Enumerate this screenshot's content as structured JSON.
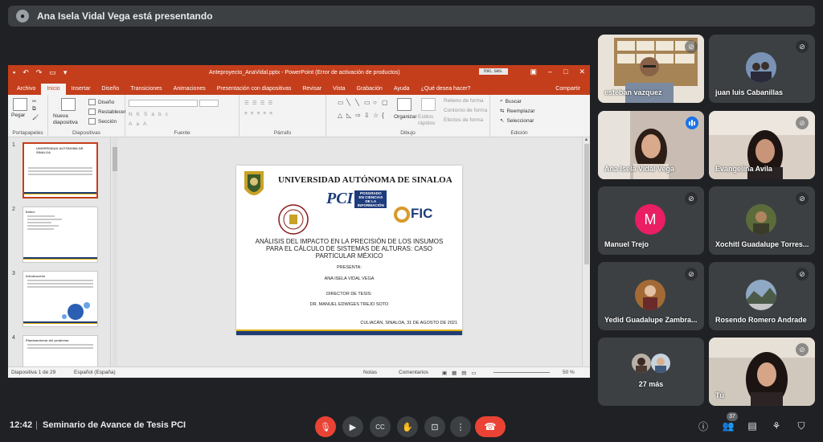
{
  "banner": {
    "text": "Ana Isela Vidal Vega está presentando"
  },
  "ppt": {
    "window_title": "Anteproyecto_AnaVidal.pptx  -  PowerPoint (Error de activación de productos)",
    "signin": "Inic. ses.",
    "tabs": [
      "Archivo",
      "Inicio",
      "Insertar",
      "Diseño",
      "Transiciones",
      "Animaciones",
      "Presentación con diapositivas",
      "Revisar",
      "Vista",
      "Grabación",
      "Ayuda",
      "¿Qué desea hacer?"
    ],
    "share": "Compartir",
    "ribbon": {
      "paste": "Pegar",
      "new_slide": "Nueva diapositiva",
      "layout": "Diseño",
      "reset": "Restablecer",
      "section": "Sección",
      "arrange": "Organizar",
      "quick_styles": "Estilos rápidos",
      "shape_fill": "Relleno de forma",
      "shape_outline": "Contorno de forma",
      "shape_effects": "Efectos de forma",
      "find": "Buscar",
      "replace": "Reemplazar",
      "select": "Seleccionar",
      "groups": [
        "Portapapeles",
        "Diapositivas",
        "Fuente",
        "Párrafo",
        "Dibujo",
        "Edición"
      ]
    },
    "thumbnails": [
      {
        "num": "1",
        "title": "UNIVERSIDAD AUTÓNOMA DE SINALOA"
      },
      {
        "num": "2",
        "title": "Índice"
      },
      {
        "num": "3",
        "title": "Introducción"
      },
      {
        "num": "4",
        "title": "Planteamiento del problema"
      }
    ],
    "slide": {
      "university": "UNIVERSIDAD AUTÓNOMA DE SINALOA",
      "pci": "PCI",
      "pci_box": "POSGRADO EN CIENCIAS DE LA INFORMACIÓN",
      "ofic": "FIC",
      "title": "ANÁLISIS DEL IMPACTO EN LA PRECISIÓN DE LOS INSUMOS PARA EL CÁLCULO DE SISTEMAS DE ALTURAS: CASO PARTICULAR MÉXICO",
      "presenta": "PRESENTA:",
      "author": "ANA ISELA VIDAL VEGA",
      "director_label": "DIRECTOR DE TESIS:",
      "director": "DR. MANUEL EDWIGES TREJO SOTO",
      "place_date": "CULIACÁN, SINALOA, 31 DE AGOSTO DE 2021"
    },
    "status": {
      "slide_of": "Diapositiva 1 de 29",
      "language": "Español (España)",
      "notes": "Notas",
      "comments": "Comentarios",
      "zoom": "50 %"
    }
  },
  "participants": [
    {
      "name": "esteban vazquez",
      "type": "video"
    },
    {
      "name": "juan luis Cabanillas",
      "type": "avatar"
    },
    {
      "name": "Ana Isela Vidal Vega",
      "type": "video"
    },
    {
      "name": "Evangelina Avila",
      "type": "video"
    },
    {
      "name": "Manuel Trejo",
      "type": "initial",
      "initial": "M",
      "color": "#e91e63"
    },
    {
      "name": "Xochitl Guadalupe Torres...",
      "type": "avatar"
    },
    {
      "name": "Yedid Guadalupe Zambra...",
      "type": "avatar"
    },
    {
      "name": "Rosendo Romero Andrade",
      "type": "avatar"
    },
    {
      "name": "27 más",
      "type": "more"
    },
    {
      "name": "Tú",
      "type": "video"
    }
  ],
  "bottom": {
    "time": "12:42",
    "separator": "|",
    "meeting": "Seminario de Avance de Tesis PCI",
    "people_count": "37"
  },
  "colors": {
    "accent_red": "#ea4335",
    "ppt_orange": "#c43e1c",
    "meet_bg": "#202124",
    "tile_bg": "#3c4043",
    "speaking_blue": "#1a73e8"
  }
}
